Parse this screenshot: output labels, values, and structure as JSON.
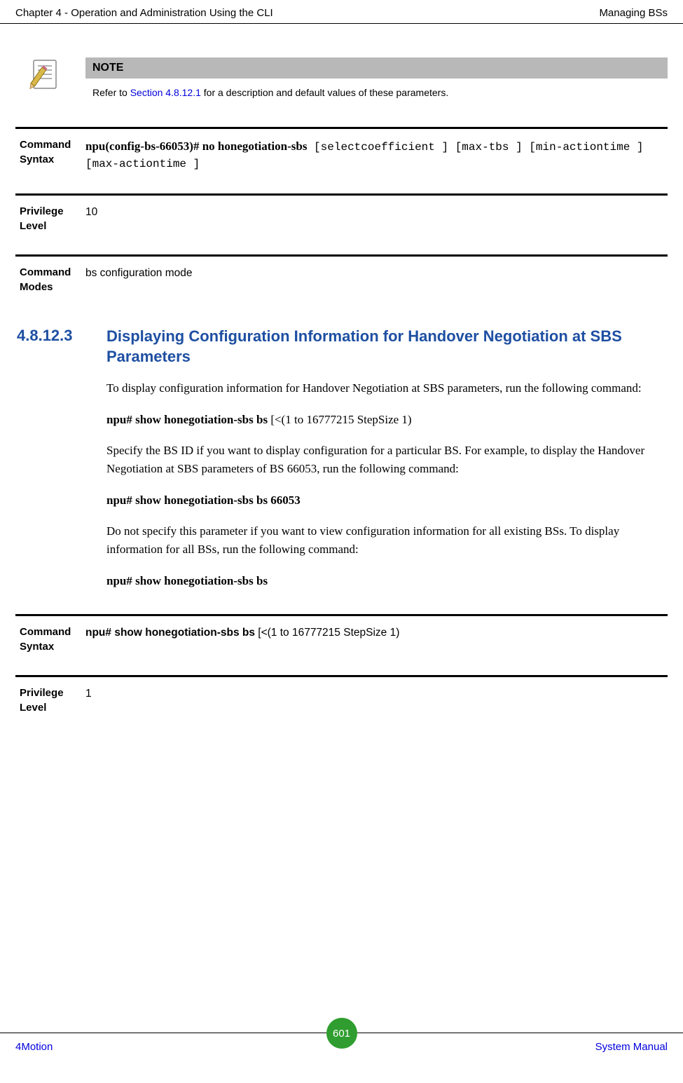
{
  "header": {
    "left": "Chapter 4 - Operation and Administration Using the CLI",
    "right": "Managing BSs"
  },
  "note": {
    "label": "NOTE",
    "body_prefix": "Refer to ",
    "link_text": "Section 4.8.12.1",
    "body_suffix": " for a description and default values of these parameters."
  },
  "blocks": {
    "cmd_syntax_label": "Command Syntax",
    "cmd_syntax_bold": "npu(config-bs-66053)# no honegotiation-sbs",
    "cmd_syntax_mono": " [selectcoefficient ] [max-tbs ] [min-actiontime ] [max-actiontime ]",
    "priv_label": "Privilege Level",
    "priv_value": "10",
    "modes_label": "Command Modes",
    "modes_value": "bs configuration mode"
  },
  "section": {
    "number": "4.8.12.3",
    "title": "Displaying Configuration Information for Handover Negotiation at SBS Parameters"
  },
  "p1": "To display configuration information for Handover Negotiation at SBS parameters, run the following command:",
  "p2_bold": "npu# show honegotiation-sbs bs",
  "p2_rest": " [<(1 to 16777215 StepSize 1)",
  "p3": "Specify the BS ID if you want to display configuration for a particular BS. For example, to display the Handover Negotiation at SBS parameters of BS 66053, run the following command:",
  "p4_bold": "npu# show honegotiation-sbs bs 66053",
  "p5": "Do not specify this parameter if you want to view configuration information for all existing BSs. To display information for all BSs, run the following command:",
  "p6_bold": "npu# show honegotiation-sbs bs",
  "blocks2": {
    "cmd_syntax_label": "Command Syntax",
    "cmd_syntax_bold": "npu# show honegotiation-sbs bs",
    "cmd_syntax_rest": " [<(1 to 16777215 StepSize 1)",
    "priv_label": "Privilege Level",
    "priv_value": "1"
  },
  "footer": {
    "left": "4Motion",
    "page": "601",
    "right": "System Manual"
  }
}
